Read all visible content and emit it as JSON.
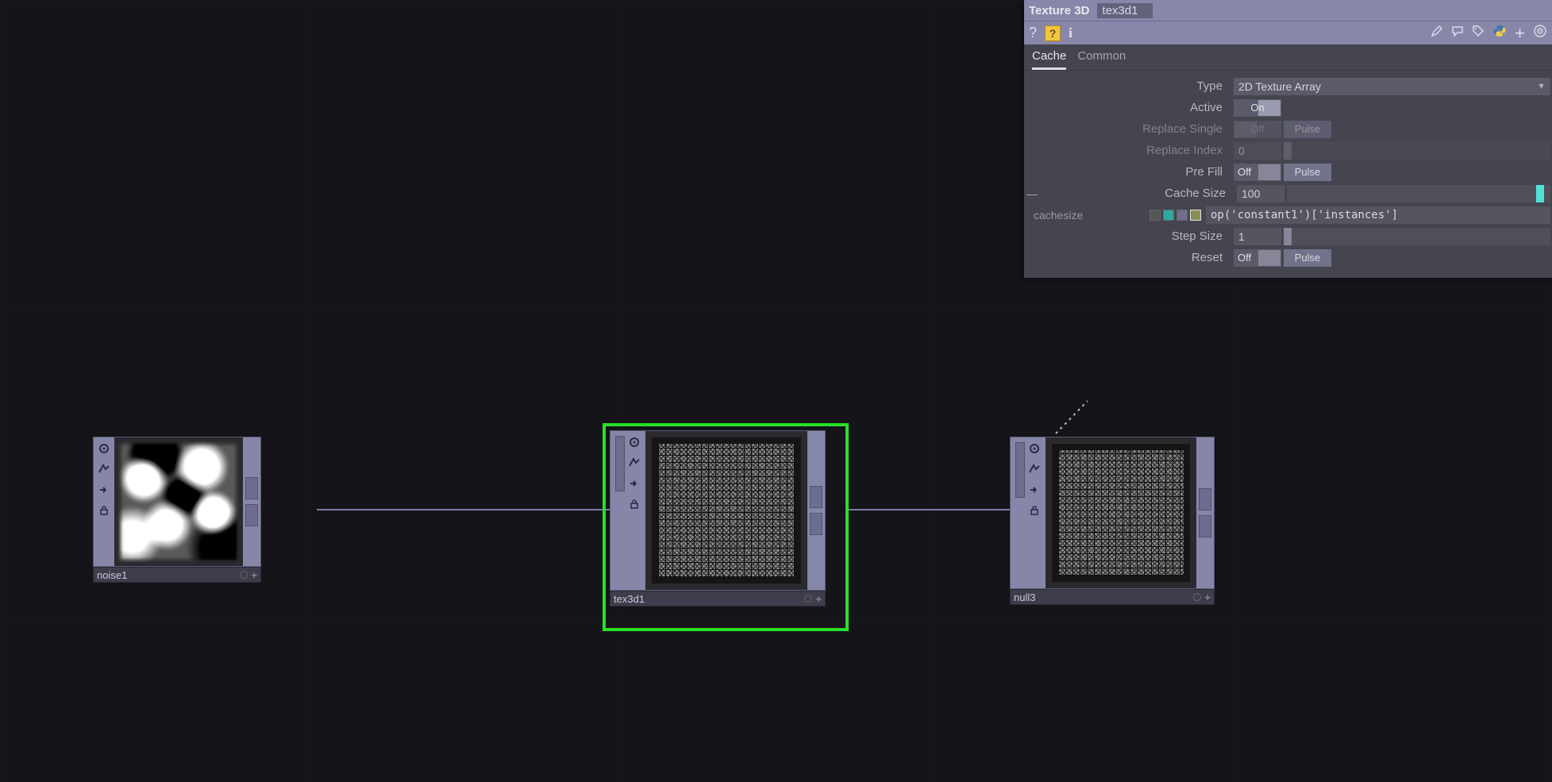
{
  "panel": {
    "op_type": "Texture 3D",
    "op_name": "tex3d1",
    "tabs": {
      "active": "Cache",
      "other": "Common"
    },
    "params": {
      "type_label": "Type",
      "type_value": "2D Texture Array",
      "active_label": "Active",
      "active_value": "On",
      "replace_single_label": "Replace Single",
      "replace_single_toggle": "Off",
      "replace_single_pulse": "Pulse",
      "replace_index_label": "Replace Index",
      "replace_index_value": "0",
      "prefill_label": "Pre Fill",
      "prefill_toggle": "Off",
      "prefill_pulse": "Pulse",
      "cachesize_label": "Cache Size",
      "cachesize_value": "100",
      "cachesize_param_name": "cachesize",
      "cachesize_expr": "op('constant1')['instances']",
      "stepsize_label": "Step Size",
      "stepsize_value": "1",
      "reset_label": "Reset",
      "reset_toggle": "Off",
      "reset_pulse": "Pulse"
    }
  },
  "nodes": {
    "noise1": {
      "name": "noise1"
    },
    "tex3d1": {
      "name": "tex3d1"
    },
    "null3": {
      "name": "null3"
    }
  },
  "icons": {
    "help_q": "?",
    "help_box_q": "?",
    "info_i": "i",
    "plus": "+"
  }
}
